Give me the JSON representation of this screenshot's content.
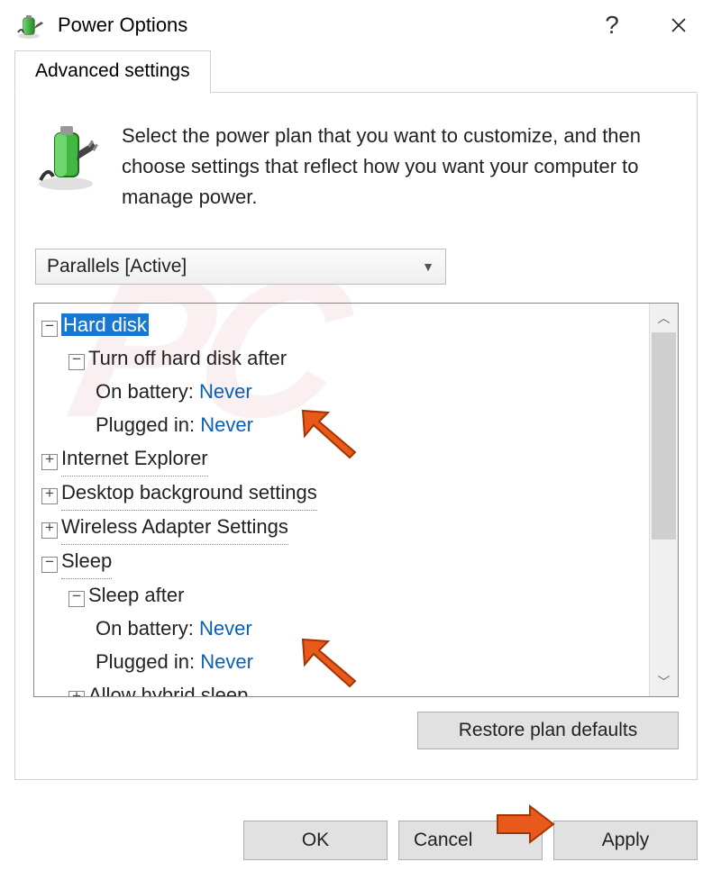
{
  "title": "Power Options",
  "tab_label": "Advanced settings",
  "intro_text": "Select the power plan that you want to customize, and then choose settings that reflect how you want your computer to manage power.",
  "plan_selected": "Parallels [Active]",
  "tree": {
    "hard_disk": {
      "label": "Hard disk",
      "turn_off": {
        "label": "Turn off hard disk after",
        "on_battery_label": "On battery:",
        "on_battery_value": "Never",
        "plugged_in_label": "Plugged in:",
        "plugged_in_value": "Never"
      }
    },
    "ie": {
      "label": "Internet Explorer"
    },
    "desktop_bg": {
      "label": "Desktop background settings"
    },
    "wireless": {
      "label": "Wireless Adapter Settings"
    },
    "sleep": {
      "label": "Sleep",
      "sleep_after": {
        "label": "Sleep after",
        "on_battery_label": "On battery:",
        "on_battery_value": "Never",
        "plugged_in_label": "Plugged in:",
        "plugged_in_value": "Never"
      },
      "hybrid": {
        "label": "Allow hybrid sleep"
      }
    }
  },
  "restore_label": "Restore plan defaults",
  "ok_label": "OK",
  "cancel_label": "Cancel",
  "apply_label": "Apply"
}
